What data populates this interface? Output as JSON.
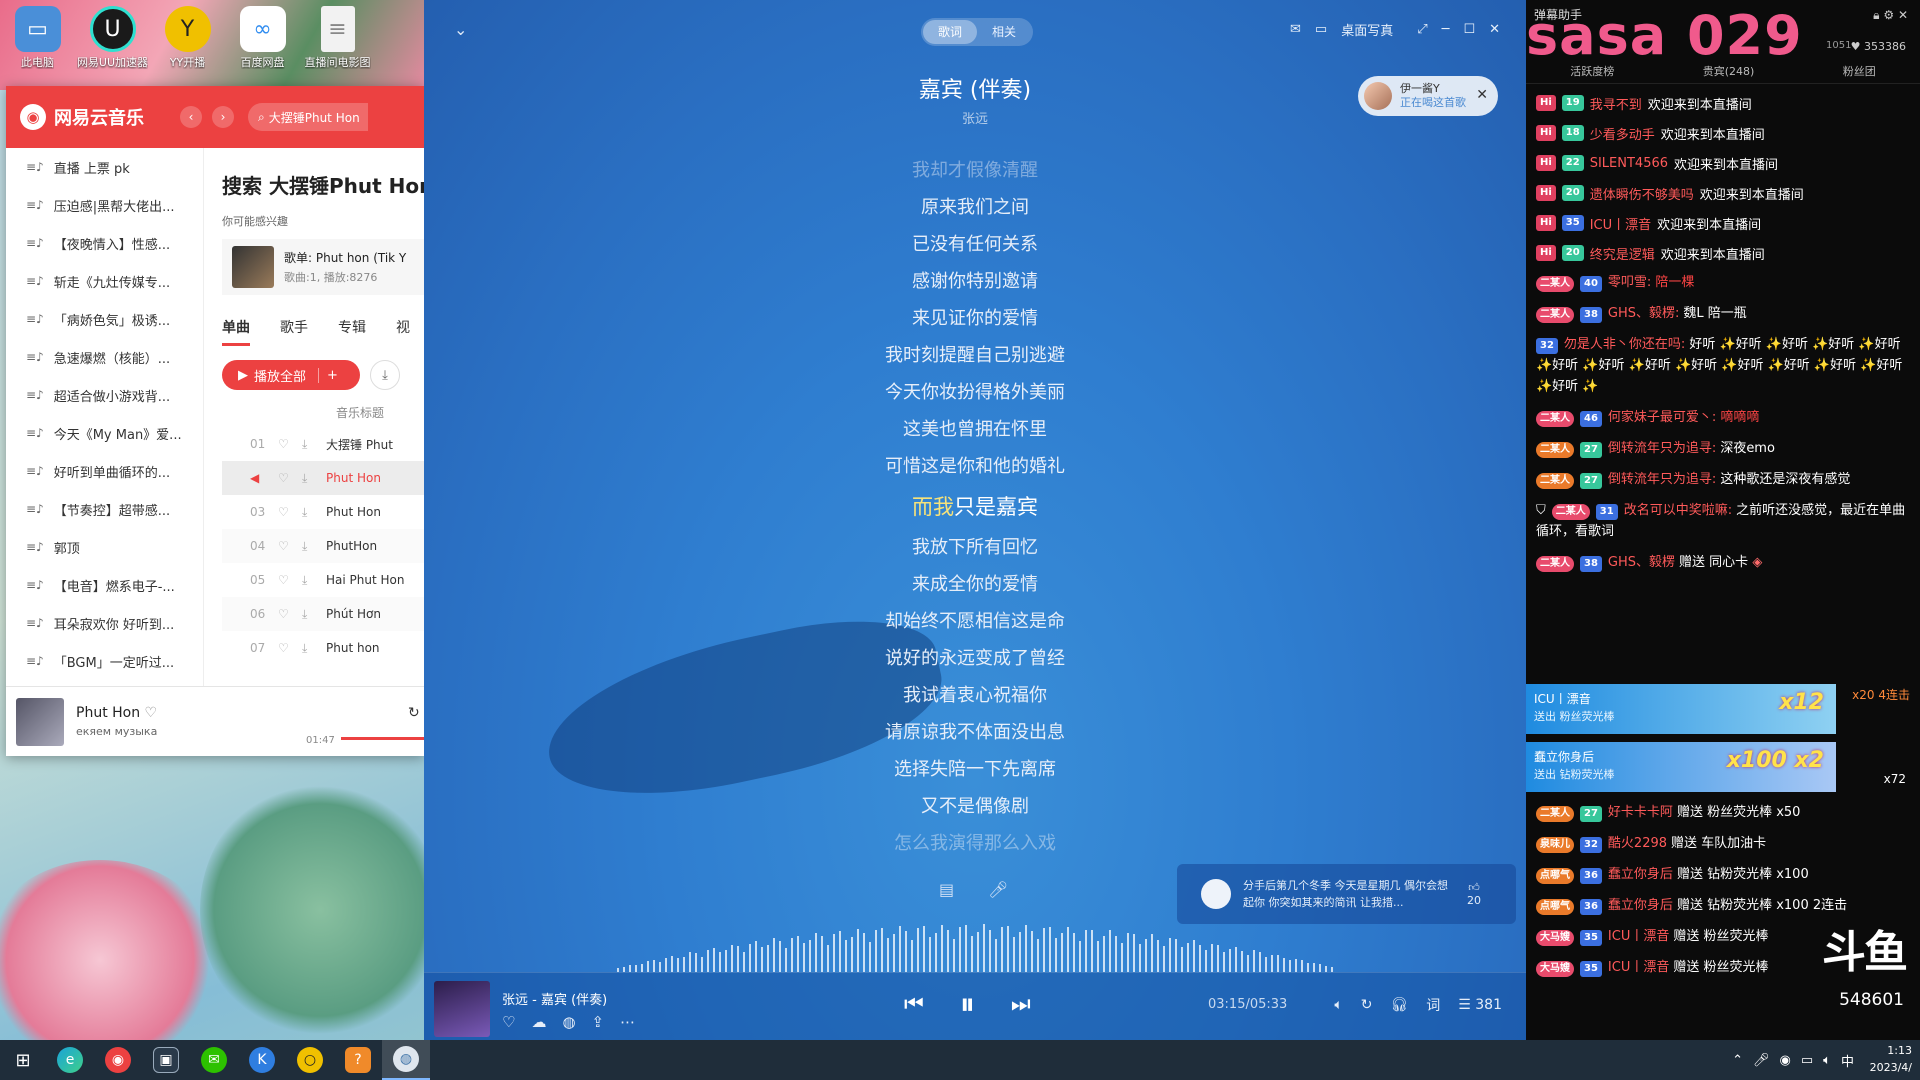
{
  "desktop": {
    "icons": [
      {
        "label": "此电脑",
        "icon": "computer-icon",
        "color": "#4a8fd8"
      },
      {
        "label": "网易UU加速器",
        "icon": "uu-accelerator-icon",
        "color": "#1a1a1a"
      },
      {
        "label": "YY开播",
        "icon": "yy-icon",
        "color": "#f0c000"
      },
      {
        "label": "百度网盘",
        "icon": "baidu-netdisk-icon",
        "color": "#2f8cf0"
      },
      {
        "label": "直播间电影图",
        "icon": "file-icon",
        "color": "#e8e8e8"
      }
    ]
  },
  "netease": {
    "app_title": "网易云音乐",
    "search_value": "大摆锤Phut Hon",
    "sidebar": [
      "直播 上票 pk",
      "压迫感|黑帮大佬出...",
      "【夜晚情入】性感...",
      "斩走《九灶传媒专...",
      "「病娇色気」极诱...",
      "急速爆燃（核能）...",
      "超适合做小游戏背...",
      "今天《My Man》爱...",
      "好听到单曲循环的...",
      "【节奏控】超带感...",
      "郭顶",
      "【电音】燃系电子-...",
      "耳朵寂欢你 好听到...",
      "「BGM」一定听过..."
    ],
    "search_title": "搜索 大摆锤Phut Hon",
    "maybe_label": "你可能感兴趣",
    "card": {
      "title": "歌单: Phut hon (Tik Y",
      "sub": "歌曲:1, 播放:8276"
    },
    "tabs": [
      "单曲",
      "歌手",
      "专辑",
      "视"
    ],
    "play_all": "播放全部",
    "col_title": "音乐标题",
    "rows": [
      {
        "num": "01",
        "title": "大摆锤 Phut"
      },
      {
        "num": "",
        "title": "Phut Hon"
      },
      {
        "num": "03",
        "title": "Phut Hon"
      },
      {
        "num": "04",
        "title": "PhutHon"
      },
      {
        "num": "05",
        "title": "Hai Phut Hon"
      },
      {
        "num": "06",
        "title": "Phút Hơn"
      },
      {
        "num": "07",
        "title": "Phut hon"
      }
    ],
    "now_playing": {
      "title": "Phut Hon",
      "artist": "екяем музыка",
      "time": "01:47"
    }
  },
  "lyrics": {
    "tab_lyrics": "歌词",
    "tab_related": "相关",
    "desk_lyrics": "桌面写真",
    "song_title": "嘉宾 (伴奏)",
    "artist": "张远",
    "listen_name": "伊一酱Y",
    "listen_status": "正在喝这首歌",
    "lines": [
      "我却才假像清醒",
      "原来我们之间",
      "已没有任何关系",
      "感谢你特别邀请",
      "来见证你的爱情",
      "我时刻提醒自己别逃避",
      "今天你妆扮得格外美丽",
      "这美也曾拥在怀里",
      "可惜这是你和他的婚礼"
    ],
    "current_highlight": "而我",
    "current_rest": "只是嘉宾",
    "lines_after": [
      "我放下所有回忆",
      "来成全你的爱情",
      "却始终不愿相信这是命",
      "说好的永远变成了曾经",
      "我试着衷心祝福你",
      "请原谅我不体面没出息",
      "选择失陪一下先离席",
      "又不是偶像剧",
      "怎么我演得那么入戏"
    ],
    "comment": "分手后第几个冬季 今天是星期几 偶尔会想起你 你突如其来的简讯 让我措...",
    "comment_likes": "20",
    "player_song": "张远 - 嘉宾 (伴奏)",
    "time": "03:15/05:33",
    "lyric_btn": "词",
    "playlist_count": "381"
  },
  "danmaku": {
    "helper_label": "弹幕助手",
    "streamer": "sasa 029",
    "fans": "353386",
    "sub_count": "1051",
    "tabs": [
      "活跃度榜",
      "贵宾(248)",
      "粉丝团"
    ],
    "welcome": [
      {
        "lv": "19",
        "user": "我寻不到",
        "msg": "欢迎来到本直播间"
      },
      {
        "lv": "18",
        "user": "少看多动手",
        "msg": "欢迎来到本直播间"
      },
      {
        "lv": "22",
        "user": "SILENT4566",
        "msg": "欢迎来到本直播间"
      },
      {
        "lv": "20",
        "user": "遗体瞬伤不够美吗",
        "msg": "欢迎来到本直播间"
      },
      {
        "lv": "35",
        "user": "ICU丨漂音",
        "msg": "欢迎来到本直播间"
      },
      {
        "lv": "20",
        "user": "终究是逻辑",
        "msg": "欢迎来到本直播间"
      }
    ],
    "chat": [
      {
        "badge": "二某人",
        "lv": "40",
        "user": "零叩雪:",
        "text": "陪一棵",
        "hot": true
      },
      {
        "badge": "二某人",
        "lv": "38",
        "user": "GHS、毅楞:",
        "text": "魏L 陪一瓶"
      },
      {
        "badge": "32",
        "lv": "",
        "user": "勿是人非丶你还在吗:",
        "text": "好听 ✨好听 ✨好听 ✨好听 ✨好听 ✨好听 ✨好听 ✨好听 ✨好听 ✨好听 ✨好听 ✨好听 ✨好听 ✨好听 ✨"
      },
      {
        "badge": "二某人",
        "lv": "46",
        "user": "何家妹子最可爱丶:",
        "text": "嘀嘀嘀",
        "hot": true
      },
      {
        "badge": "二某人",
        "lv": "27",
        "user": "倒转流年只为追寻:",
        "text": "深夜emo"
      },
      {
        "badge": "二某人",
        "lv": "27",
        "user": "倒转流年只为追寻:",
        "text": "这种歌还是深夜有感觉"
      },
      {
        "badge": "二某人",
        "lv": "31",
        "user": "改名可以中奖啦嘛:",
        "text": "之前听还没感觉，最近在单曲循环，看歌词"
      },
      {
        "badge": "二某人",
        "lv": "38",
        "user": "GHS、毅楞",
        "text": "赠送 同心卡"
      }
    ],
    "banner1": {
      "user": "ICU丨漂音",
      "action": "送出 粉丝荧光棒",
      "combo": "x12"
    },
    "banner2": {
      "user": "蠢立你身后",
      "action": "送出 钻粉荧光棒",
      "combo": "x100 x2"
    },
    "gifts": [
      {
        "badge": "二某人",
        "lv": "27",
        "user": "好卡卡卡阿",
        "text": "赠送 粉丝荧光棒",
        "count": "x50"
      },
      {
        "badge": "泉味儿",
        "lv": "32",
        "user": "酷火2298",
        "text": "赠送 车队加油卡",
        "count": ""
      },
      {
        "badge": "点哪气",
        "lv": "36",
        "user": "蠢立你身后",
        "text": "赠送 钻粉荧光棒",
        "count": "x100"
      },
      {
        "badge": "点哪气",
        "lv": "36",
        "user": "蠢立你身后",
        "text": "赠送 钻粉荧光棒",
        "count": "x100 2连击"
      },
      {
        "badge": "大马嫂",
        "lv": "35",
        "user": "ICU丨漂音",
        "text": "赠送 粉丝荧光棒",
        "count": ""
      },
      {
        "badge": "大马嫂",
        "lv": "35",
        "user": "ICU丨漂音",
        "text": "赠送 粉丝荧光棒",
        "count": ""
      }
    ],
    "x20": "x20 4连击",
    "x72": "x72",
    "logo": "斗鱼",
    "count": "548601"
  },
  "taskbar": {
    "ime": "中",
    "time": "1:13",
    "date": "2023/4/"
  }
}
